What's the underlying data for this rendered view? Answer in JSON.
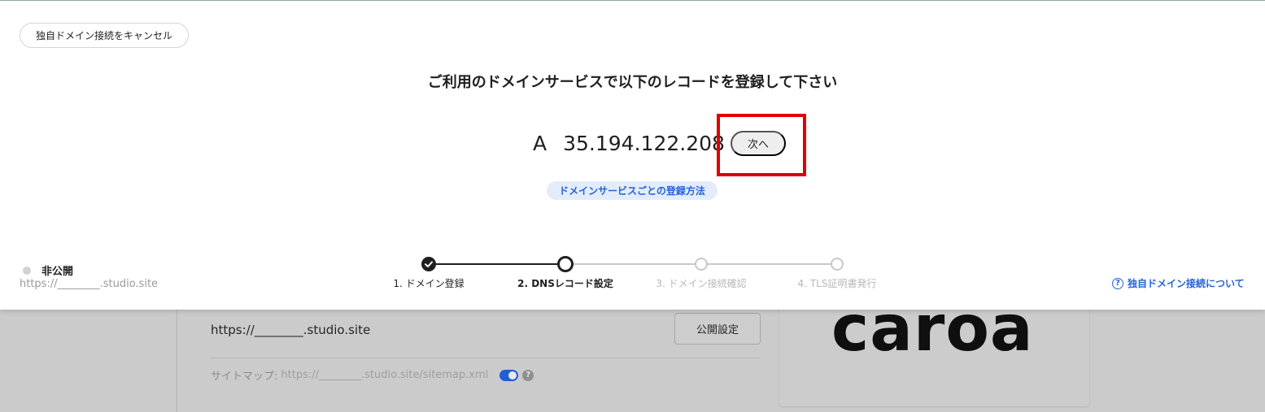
{
  "modal": {
    "cancel_label": "独自ドメイン接続をキャンセル",
    "instruction": "ご利用のドメインサービスで以下のレコードを登録して下さい",
    "record_type": "A",
    "record_value": "35.194.122.208",
    "next_label": "次へ",
    "howto_label": "ドメインサービスごとの登録方法",
    "status_label": "非公開",
    "status_url": "https://________.studio.site",
    "about_label": "独自ドメイン接続について",
    "about_icon": "question-circle-icon",
    "highlight_color": "#e00000"
  },
  "stepper": {
    "steps": [
      {
        "label": "1. ドメイン登録",
        "state": "done"
      },
      {
        "label": "2. DNSレコード設定",
        "state": "current"
      },
      {
        "label": "3. ドメイン接続確認",
        "state": "pending"
      },
      {
        "label": "4. TLS証明書発行",
        "state": "pending"
      }
    ]
  },
  "background": {
    "site_url": "https://________.studio.site",
    "publish_settings_label": "公開設定",
    "sitemap_label": "サイトマップ:",
    "sitemap_url": "https://________.studio.site/sitemap.xml",
    "sitemap_toggle_on": true,
    "logo_text": "caroa"
  },
  "colors": {
    "accent_blue": "#2563d6",
    "text_dark": "#1f1f1f",
    "pending_gray": "#c8c8c8"
  }
}
